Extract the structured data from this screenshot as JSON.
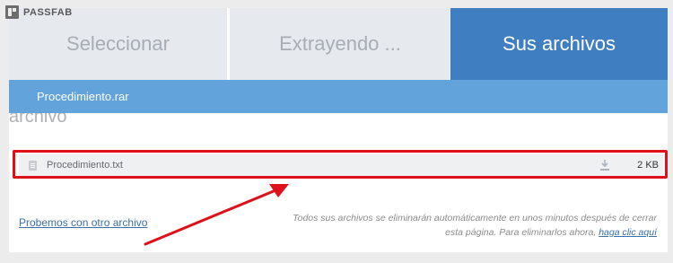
{
  "brand": {
    "name": "PASSFAB",
    "logo_icon": "passfab-logo-icon"
  },
  "steps": [
    {
      "label": "Seleccionar",
      "active": false
    },
    {
      "label": "Extrayendo ...",
      "active": false
    },
    {
      "label": "Sus archivos",
      "active": true
    }
  ],
  "archive": {
    "name": "Procedimiento.rar",
    "heading": "archivo"
  },
  "files": [
    {
      "name": "Procedimiento.txt",
      "size": "2 KB",
      "icon": "document-icon",
      "action_icon": "download-icon"
    }
  ],
  "links": {
    "try_another": "Probemos con otro archivo"
  },
  "notice": {
    "text": "Todos sus archivos se eliminarán automáticamente en unos minutos después de cerrar esta página. Para eliminarlos ahora,",
    "link": "haga clic aquí"
  },
  "colors": {
    "active_step": "#3f7fc1",
    "inactive_step": "#e6e9ee",
    "file_bar": "#62a3db",
    "highlight": "#e0101a",
    "link": "#3a6fa8"
  }
}
